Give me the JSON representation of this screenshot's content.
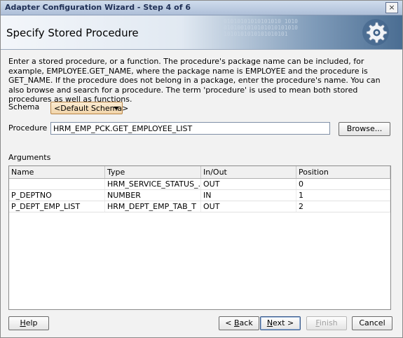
{
  "window": {
    "title": "Adapter Configuration Wizard - Step 4 of 6",
    "close_symbol": "×"
  },
  "header": {
    "heading": "Specify Stored Procedure",
    "binary_art": "01010101010101010 1010\n0101001010101010101010\n1010101010101010101"
  },
  "description": "Enter a stored procedure, or a function. The procedure's package name can be included, for example, EMPLOYEE.GET_NAME, where the package name is EMPLOYEE and the procedure is GET_NAME.  If the procedure does not belong in a package, enter the procedure's name. You can also browse and search for a procedure. The term 'procedure' is used to mean both stored procedures as well as functions.",
  "schema": {
    "label": "Schema",
    "selected": "<Default Schema>"
  },
  "procedure": {
    "label": "Procedure",
    "value": "HRM_EMP_PCK.GET_EMPLOYEE_LIST",
    "browse_label": "Browse..."
  },
  "arguments": {
    "label": "Arguments",
    "columns": [
      "Name",
      "Type",
      "In/Out",
      "Position"
    ],
    "rows": [
      [
        "",
        "HRM_SERVICE_STATUS_...",
        "OUT",
        "0"
      ],
      [
        "P_DEPTNO",
        "NUMBER",
        "IN",
        "1"
      ],
      [
        "P_DEPT_EMP_LIST",
        "HRM_DEPT_EMP_TAB_T",
        "OUT",
        "2"
      ]
    ]
  },
  "footer": {
    "help": {
      "mnemonic": "H",
      "rest": "elp"
    },
    "back": {
      "prefix": "< ",
      "mnemonic": "B",
      "rest": "ack"
    },
    "next": {
      "mnemonic": "N",
      "rest": "ext >"
    },
    "finish": {
      "mnemonic": "F",
      "rest": "inish",
      "enabled": false
    },
    "cancel": {
      "label": "Cancel"
    }
  },
  "icons": {
    "header_graphic": "gear-icon",
    "combo_arrow": "chevron-down-icon"
  }
}
